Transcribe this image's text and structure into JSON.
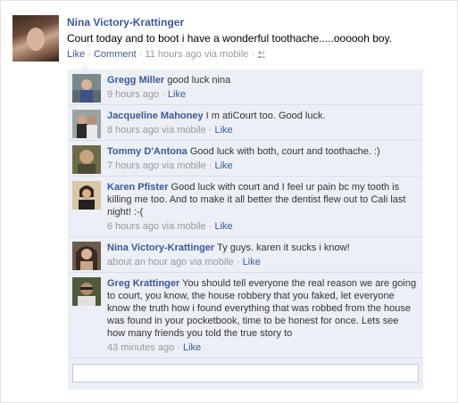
{
  "post": {
    "author": "Nina Victory-Krattinger",
    "text": "Court today and to boot i have a wonderful toothache.....oooooh boy.",
    "actions": {
      "like": "Like",
      "sep1": " · ",
      "comment": "Comment",
      "sep2": " · ",
      "time": "11 hours ago via mobile",
      "sep3": " · "
    },
    "audience_icon": "people-icon"
  },
  "comments": [
    {
      "name": "Gregg Miller",
      "text": "good luck nina",
      "time": "9 hours ago",
      "sep": " · ",
      "like": "Like"
    },
    {
      "name": "Jacqueline Mahoney",
      "text": "I m atiCourt too. Good luck.",
      "time": "8 hours ago via mobile",
      "sep": " · ",
      "like": "Like"
    },
    {
      "name": "Tommy D'Antona",
      "text": "Good luck with both, court and toothache. :)",
      "time": "7 hours ago via mobile",
      "sep": " · ",
      "like": "Like"
    },
    {
      "name": "Karen Pfister",
      "text": "Good luck with court and I feel ur pain bc my tooth is killing me too. And to make it all better the dentist flew out to Cali last night! :-(",
      "time": "6 hours ago via mobile",
      "sep": " · ",
      "like": "Like"
    },
    {
      "name": "Nina Victory-Krattinger",
      "text": "Ty guys. karen it sucks i know!",
      "time": "about an hour ago via mobile",
      "sep": " · ",
      "like": "Like"
    },
    {
      "name": "Greg Krattinger",
      "text": "You should tell everyone the real reason we are going to court, you know, the house robbery that you faked, let everyone know the truth how i found everything that was robbed from the house was found in your pocketbook, time to be honest for once. Lets see how many friends you told the true story to",
      "time": "43 minutes ago",
      "sep": " · ",
      "like": "Like"
    }
  ],
  "reply": {
    "value": "",
    "placeholder": ""
  }
}
